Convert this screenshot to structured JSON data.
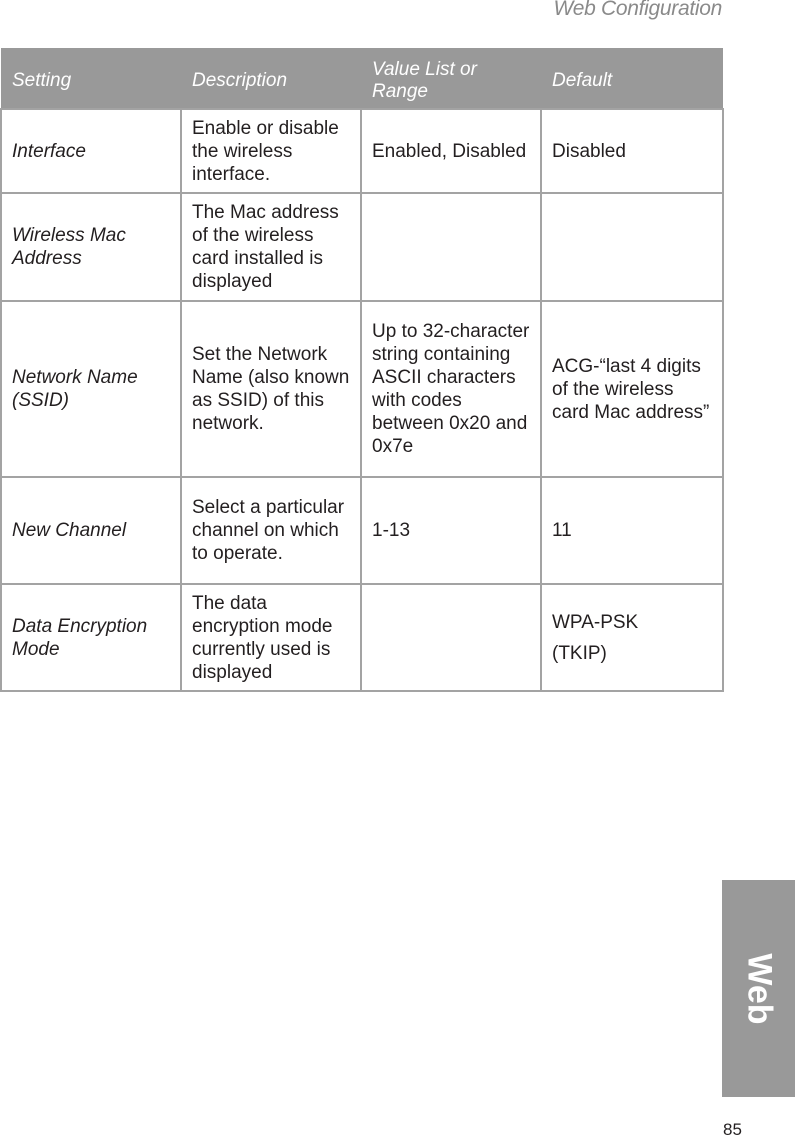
{
  "header": {
    "title": "Web Configuration"
  },
  "table": {
    "columns": [
      "Setting",
      "Description",
      "Value List or Range",
      "Default"
    ],
    "rows": [
      {
        "setting": "Interface",
        "description": "Enable or disable the wireless interface.",
        "values": "Enabled, Disabled",
        "default": [
          "Disabled"
        ]
      },
      {
        "setting": "Wireless Mac Address",
        "description": "The Mac address of the wireless card installed is displayed",
        "values": "",
        "default": []
      },
      {
        "setting": "Network Name (SSID)",
        "description": "Set the Network Name (also known as SSID) of this network.",
        "values": "Up to 32-character string containing ASCII characters with codes between 0x20 and 0x7e",
        "default": [
          "ACG-“last 4 digits of the wireless card Mac address”"
        ]
      },
      {
        "setting": "New Channel",
        "description": "Select a particular channel on which to operate.",
        "values": "1-13",
        "default": [
          "11"
        ]
      },
      {
        "setting": "Data Encryption Mode",
        "description": "The data encryption mode currently used is displayed",
        "values": "",
        "default": [
          "WPA-PSK",
          "(TKIP)"
        ]
      }
    ]
  },
  "side_tab": {
    "label": "Web"
  },
  "footer": {
    "page_number": "85"
  },
  "colors": {
    "header_bg": "#999999",
    "border": "#a3a3a3",
    "title_gray": "#8a8a8a"
  }
}
